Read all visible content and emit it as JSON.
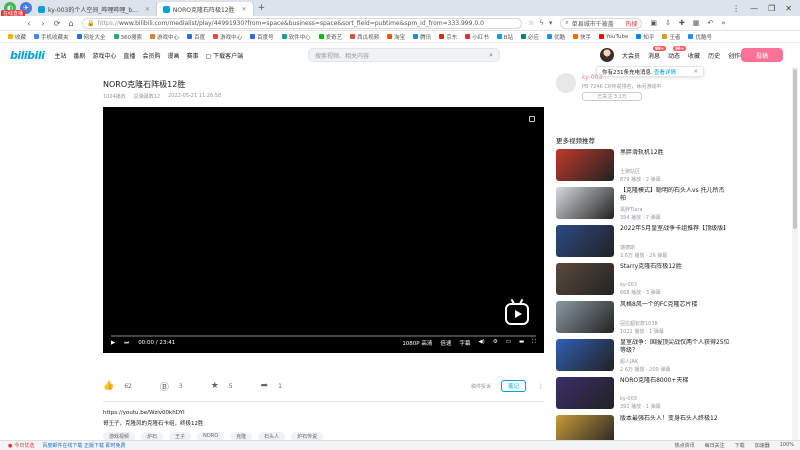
{
  "browser": {
    "live_badge": "在线直播",
    "tabs": [
      {
        "label": "ky-003的个人空间_哔哩哔哩_b...",
        "active": false
      },
      {
        "label": "NORO克隆石阵极12胜",
        "active": true
      }
    ],
    "new_tab": "+",
    "window_controls": [
      "⋮",
      "—",
      "❐",
      "✕"
    ],
    "nav": {
      "back": "‹",
      "forward": "›",
      "refresh": "⟳",
      "home": "⌂"
    },
    "url_scheme": "https://",
    "url_rest": "www.bilibili.com/medialist/play/44991930?from=space&business=space&sort_field=pubtime&spm_id_from=333.999.0.0",
    "search_placeholder": "单县城市千被盖",
    "search_hot": "热搜",
    "bookmarks": [
      {
        "label": "收藏",
        "color": "#f4b400"
      },
      {
        "label": "手机收藏夹",
        "color": "#4285f4"
      },
      {
        "label": "网址大全",
        "color": "#1a73e8"
      },
      {
        "label": "360搜索",
        "color": "#27ae60"
      },
      {
        "label": "游戏中心",
        "color": "#e67e22"
      },
      {
        "label": "百度",
        "color": "#2d6ae3"
      },
      {
        "label": "游戏中心",
        "color": "#e74c3c"
      },
      {
        "label": "百度号",
        "color": "#2d6ae3"
      },
      {
        "label": "软件中心",
        "color": "#16a085"
      },
      {
        "label": "爱奇艺",
        "color": "#00be06"
      },
      {
        "label": "西瓜视频",
        "color": "#e74c3c"
      },
      {
        "label": "淘宝",
        "color": "#ff5000"
      },
      {
        "label": "腾讯",
        "color": "#1e88e5"
      },
      {
        "label": "京东",
        "color": "#e1251b"
      },
      {
        "label": "小红书",
        "color": "#ff2442"
      },
      {
        "label": "B站",
        "color": "#00a1d6"
      },
      {
        "label": "必应",
        "color": "#008373"
      },
      {
        "label": "优酷",
        "color": "#1e90ff"
      },
      {
        "label": "快手",
        "color": "#ff6a00"
      },
      {
        "label": "YouTube",
        "color": "#ff0000"
      },
      {
        "label": "知乎",
        "color": "#0084ff"
      },
      {
        "label": "王者",
        "color": "#d4a017"
      },
      {
        "label": "优酷号",
        "color": "#1e90ff"
      }
    ]
  },
  "header": {
    "logo": "bilibili",
    "nav": [
      "主站",
      "番剧",
      "游戏中心",
      "直播",
      "会员购",
      "漫画",
      "赛事",
      "下载客户端"
    ],
    "search_placeholder": "搜索视频、相关内容",
    "right_items": [
      {
        "label": "大会员",
        "badge": ""
      },
      {
        "label": "消息",
        "badge": "99+"
      },
      {
        "label": "动态",
        "badge": "99+"
      },
      {
        "label": "收藏",
        "badge": ""
      },
      {
        "label": "历史",
        "badge": ""
      },
      {
        "label": "创作中心",
        "badge": ""
      }
    ],
    "upload": "投稿",
    "notice_text": "你有231条充电消息",
    "notice_link": "查看详情",
    "notice_close": "✕"
  },
  "video": {
    "title": "NORO克隆石阵极12胜",
    "views": "1024播放",
    "danmaku": "总弹幕数12",
    "date": "2022-05-21 11:26:58",
    "current_time": "00:00",
    "total_time": "23:41",
    "quality": "1080P 高清",
    "control_labels": [
      "倍速",
      "字幕"
    ],
    "likes": "62",
    "coins": "3",
    "favorites": "5",
    "shares": "1",
    "report": "稿件投诉",
    "note": "笔记",
    "desc_link": "https://youtu.be/Wzlv00khDYI",
    "desc_text": "哥王子，克隆风的克隆石卡组，终极12胜",
    "tags": [
      "游戏视频",
      "炉石",
      "王子",
      "NORO",
      "克隆",
      "石头人",
      "炉石传说"
    ]
  },
  "sidebar": {
    "up_name": "ky-003",
    "up_desc": "PB 7246 CR传说排名，休闲游戏中",
    "follow": "已关注 3.1万",
    "rec_title": "更多视频推荐",
    "recs": [
      {
        "title": "黑胖滑轨机12胜",
        "up": "土牌站区",
        "stats": "879 播放 · 2 弹幕",
        "color": "#c0392b"
      },
      {
        "title": "【克隆模式】聪明的石头人vs 托儿所杰帕",
        "up": "黑胖Tiara",
        "stats": "354 播放 · 7 弹幕",
        "color": "#d6dbe0"
      },
      {
        "title": "2022年5月皇室战争卡组推荐【顶级版】",
        "up": "瑞德斯",
        "stats": "3.6万 播放 · 26 弹幕",
        "color": "#2c4a86"
      },
      {
        "title": "Starry克隆石阵极12胜",
        "up": "ky-003",
        "stats": "668 播放 · 3 弹幕",
        "color": "#5a4a3d"
      },
      {
        "title": "风格8风一个的FC克隆芯片楼",
        "up": "冠拉超钦旅1038",
        "stats": "1021 播放 · 1 弹幕",
        "color": "#8a9aa3"
      },
      {
        "title": "皇室战争：国服顶尖战仅两个人获得25位等级？",
        "up": "超人JAK",
        "stats": "2.6万 播放 · 209 弹幕",
        "color": "#2f5fb3"
      },
      {
        "title": "NORO克隆石8000+天梯",
        "up": "ky-003",
        "stats": "391 播放 · 1 弹幕",
        "color": "#3b2e6b"
      },
      {
        "title": "版本最强石头人！变身石头人终极12",
        "up": "",
        "stats": "",
        "color": "#c89a3a"
      }
    ]
  },
  "statusbar": {
    "left": [
      {
        "label": "今日优选",
        "color": "red"
      },
      {
        "label": "百度邮件在线下载 正版下载 即时免费",
        "color": "blue"
      }
    ],
    "right": [
      "热点资讯",
      "每日关注",
      "下载",
      "加速器",
      "100%"
    ]
  }
}
